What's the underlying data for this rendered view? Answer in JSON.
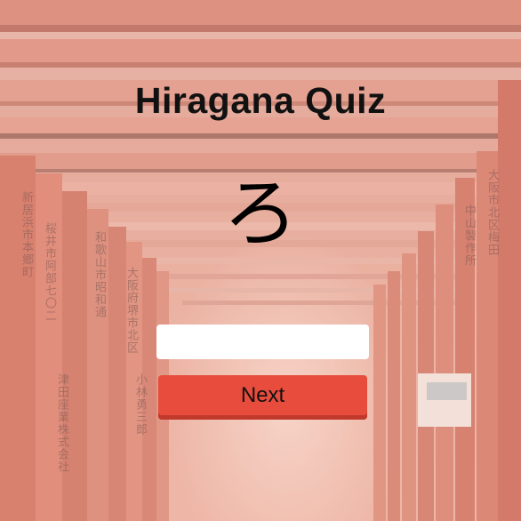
{
  "quiz": {
    "title": "Hiragana Quiz",
    "character": "ろ",
    "answer_value": "",
    "answer_placeholder": "",
    "next_label": "Next"
  },
  "colors": {
    "accent": "#e74c3c",
    "accent_shadow": "#c0392b",
    "gate_red": "#c9503a"
  },
  "background": {
    "inscriptions": [
      "桜井市阿部七〇二",
      "津田座業株式会社",
      "大阪府堺市北区",
      "和歌山市昭和通",
      "中山製作所",
      "小林勇三郎",
      "大阪市北区梅田",
      "新居浜市本郷町"
    ]
  }
}
